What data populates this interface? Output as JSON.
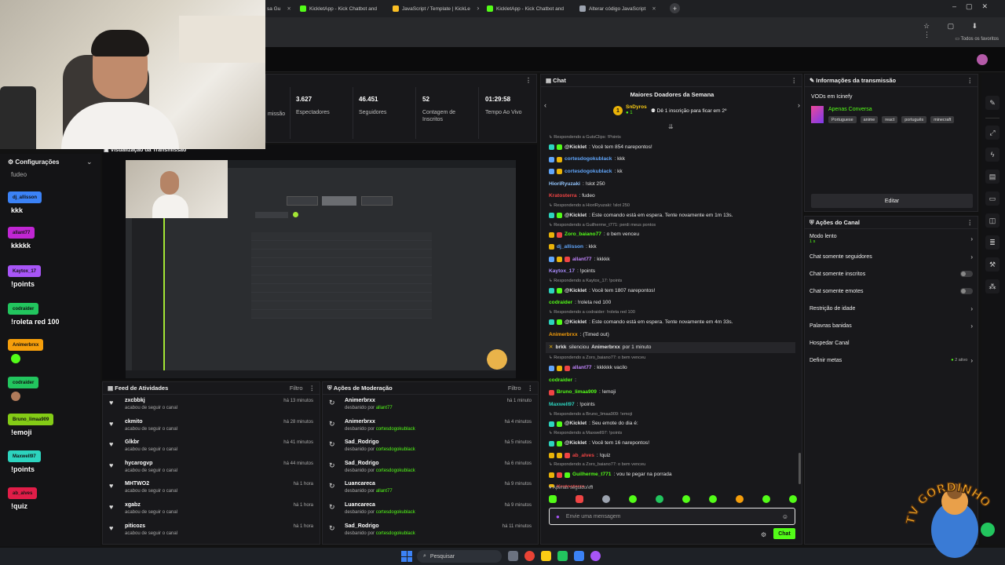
{
  "browser": {
    "tabs": [
      {
        "label": "sa Gu"
      },
      {
        "label": "KickletApp - Kick Chatbot and"
      },
      {
        "label": "JavaScript / Template | KickLe"
      },
      {
        "label": "KickletApp - Kick Chatbot and"
      },
      {
        "label": "Alterar código JavaScript"
      }
    ],
    "bookmarks_label": "Todos os favoritos"
  },
  "left_chat": {
    "config_label": "Configurações",
    "first_msg": "fudeo",
    "entries": [
      {
        "name": "dj_allisson",
        "color": "#3b82f6",
        "msg": "kkk"
      },
      {
        "name": "allant77",
        "color": "#c026d3",
        "msg": "kkkkk"
      },
      {
        "name": "Kaytox_17",
        "color": "#a855f7",
        "msg": "!points"
      },
      {
        "name": "codraider",
        "color": "#22c55e",
        "msg": "!roleta red 100"
      },
      {
        "name": "Animerbrxx",
        "color": "#f59e0b",
        "msg": ""
      },
      {
        "name": "codraider",
        "color": "#22c55e",
        "msg": ""
      },
      {
        "name": "Bruno_limaa909",
        "color": "#84cc16",
        "msg": "!emoji"
      },
      {
        "name": "Maxwell97",
        "color": "#2dd4bf",
        "msg": "!points"
      },
      {
        "name": "ab_alves",
        "color": "#e11d48",
        "msg": "!quiz"
      }
    ]
  },
  "stats": {
    "partial_label": "missão",
    "items": [
      {
        "value": "3.627",
        "label": "Espectadores"
      },
      {
        "value": "46.451",
        "label": "Seguidores"
      },
      {
        "value": "52",
        "label": "Contagem de Inscritos"
      },
      {
        "value": "01:29:58",
        "label": "Tempo Ao Vivo"
      }
    ]
  },
  "preview": {
    "title": "Visualização da Transmissão"
  },
  "activity": {
    "title": "Feed de Atividades",
    "filter": "Filtro",
    "items": [
      {
        "name": "zxcbbkj",
        "sub": "acabou de seguir o canal",
        "time": "há 13 minutos"
      },
      {
        "name": "ckmito",
        "sub": "acabou de seguir o canal",
        "time": "há 28 minutos"
      },
      {
        "name": "Glkbr",
        "sub": "acabou de seguir o canal",
        "time": "há 41 minutos"
      },
      {
        "name": "hycarogvp",
        "sub": "acabou de seguir o canal",
        "time": "há 44 minutos"
      },
      {
        "name": "MHTWO2",
        "sub": "acabou de seguir o canal",
        "time": "há 1 hora"
      },
      {
        "name": "xgabz",
        "sub": "acabou de seguir o canal",
        "time": "há 1 hora"
      },
      {
        "name": "piticozs",
        "sub": "acabou de seguir o canal",
        "time": "há 1 hora"
      }
    ]
  },
  "moderation": {
    "title": "Ações de Moderação",
    "filter": "Filtro",
    "items": [
      {
        "name": "Animerbrxx",
        "sub": "desbanido por",
        "by": "allant77",
        "time": "há 1 minuto"
      },
      {
        "name": "Animerbrxx",
        "sub": "desbanido por",
        "by": "cortesdogokublack",
        "time": "há 4 minutos"
      },
      {
        "name": "Sad_Rodrigo",
        "sub": "desbanido por",
        "by": "cortesdogokublack",
        "time": "há 5 minutos"
      },
      {
        "name": "Sad_Rodrigo",
        "sub": "desbanido por",
        "by": "cortesdogokublack",
        "time": "há 6 minutos"
      },
      {
        "name": "Luancareca",
        "sub": "desbanido por",
        "by": "allant77",
        "time": "há 9 minutos"
      },
      {
        "name": "Luancareca",
        "sub": "desbanido por",
        "by": "cortesdogokublack",
        "time": "há 9 minutos"
      },
      {
        "name": "Sad_Rodrigo",
        "sub": "desbanido por",
        "by": "cortesdogokublack",
        "time": "há 11 minutos"
      }
    ]
  },
  "chat": {
    "title": "Chat",
    "donors_title": "Maiores Doadores da Semana",
    "donor_name": "SnDyros",
    "donor_count": "1",
    "donor_note": "Dê 1 inscrição para ficar em 2º",
    "messages": [
      {
        "type": "reply",
        "text": "Respondendo a GutsClips: !Points"
      },
      {
        "type": "msg",
        "user": "@Kicklet",
        "ucolor": "#e6e6e6",
        "text": ": Você tem 854 narepontos!",
        "badges": [
          "#2dd4bf",
          "#53fc18"
        ]
      },
      {
        "type": "msg",
        "user": "cortesdogokublack",
        "ucolor": "#60a5fa",
        "text": ": kkk",
        "badges": [
          "#60a5fa",
          "#eab308"
        ]
      },
      {
        "type": "msg",
        "user": "cortesdogokublack",
        "ucolor": "#60a5fa",
        "text": ": kk",
        "badges": [
          "#60a5fa",
          "#eab308"
        ]
      },
      {
        "type": "msg",
        "user": "HioriRyuzaki",
        "ucolor": "#93c5fd",
        "text": ": !slot 250",
        "badges": []
      },
      {
        "type": "msg",
        "user": "Kratosterra",
        "ucolor": "#ef4444",
        "text": ": fudeo",
        "badges": []
      },
      {
        "type": "reply",
        "text": "Respondendo a HioriRyuzaki: !slot 250"
      },
      {
        "type": "msg",
        "user": "@Kicklet",
        "ucolor": "#e6e6e6",
        "text": ": Este comando está em espera. Tente novamente em 1m 13s.",
        "badges": [
          "#2dd4bf",
          "#53fc18"
        ]
      },
      {
        "type": "reply",
        "text": "Respondendo a Guilherme_t771: perdi meus pontos"
      },
      {
        "type": "msg",
        "user": "Zoro_baiano77",
        "ucolor": "#53fc18",
        "text": ": o bem venceu",
        "badges": [
          "#eab308",
          "#ef4444"
        ]
      },
      {
        "type": "msg",
        "user": "dj_allisson",
        "ucolor": "#60a5fa",
        "text": ": kkk",
        "badges": [
          "#eab308"
        ]
      },
      {
        "type": "msg",
        "user": "allant77",
        "ucolor": "#c084fc",
        "text": ": kkkkk",
        "badges": [
          "#60a5fa",
          "#eab308",
          "#ef4444"
        ]
      },
      {
        "type": "msg",
        "user": "Kaytox_17",
        "ucolor": "#a78bfa",
        "text": ": !points",
        "badges": []
      },
      {
        "type": "reply",
        "text": "Respondendo a Kaytox_17: !points"
      },
      {
        "type": "msg",
        "user": "@Kicklet",
        "ucolor": "#e6e6e6",
        "text": ": Você tem 1807 narepontos!",
        "badges": [
          "#2dd4bf",
          "#53fc18"
        ]
      },
      {
        "type": "msg",
        "user": "codraider",
        "ucolor": "#53fc18",
        "text": ": !roleta red 100",
        "badges": []
      },
      {
        "type": "reply",
        "text": "Respondendo a codraider: !roleta red 100"
      },
      {
        "type": "msg",
        "user": "@Kicklet",
        "ucolor": "#e6e6e6",
        "text": ": Este comando está em espera. Tente novamente em 4m 33s.",
        "badges": [
          "#2dd4bf",
          "#53fc18"
        ]
      },
      {
        "type": "msg",
        "user": "Animerbrxx",
        "ucolor": "#f59e0b",
        "text": ":   (Timed out)",
        "badges": []
      },
      {
        "type": "sys",
        "user": "brkk",
        "text": " silenciou ",
        "target": "Animerbrxx",
        "tail": " por 1 minuto"
      },
      {
        "type": "reply",
        "text": "Respondendo a Zoro_baiano77: o bem venceu"
      },
      {
        "type": "msg",
        "user": "allant77",
        "ucolor": "#c084fc",
        "text": ": kkkkkk vacilo",
        "badges": [
          "#60a5fa",
          "#eab308",
          "#ef4444"
        ]
      },
      {
        "type": "msg",
        "user": "codraider",
        "ucolor": "#53fc18",
        "text": ":",
        "badges": []
      },
      {
        "type": "msg",
        "user": "Bruno_limaa909",
        "ucolor": "#53fc18",
        "text": ": !emoji",
        "badges": [
          "#ef4444"
        ]
      },
      {
        "type": "msg",
        "user": "Maxwell97",
        "ucolor": "#2dd4bf",
        "text": ": !points",
        "badges": []
      },
      {
        "type": "reply",
        "text": "Respondendo a Bruno_limaa909: !emoji"
      },
      {
        "type": "msg",
        "user": "@Kicklet",
        "ucolor": "#e6e6e6",
        "text": ": Seu emote do dia é:",
        "badges": [
          "#2dd4bf",
          "#53fc18"
        ]
      },
      {
        "type": "reply",
        "text": "Respondendo a Maxwell97: !points"
      },
      {
        "type": "msg",
        "user": "@Kicklet",
        "ucolor": "#e6e6e6",
        "text": ": Você tem 16 narepontos!",
        "badges": [
          "#2dd4bf",
          "#53fc18"
        ]
      },
      {
        "type": "msg",
        "user": "ab_alves",
        "ucolor": "#ef4444",
        "text": ": !quiz",
        "badges": [
          "#eab308",
          "#eab308",
          "#ef4444"
        ]
      },
      {
        "type": "reply",
        "text": "Respondendo a Zoro_baiano77: o bem venceu"
      },
      {
        "type": "msg",
        "user": "Guilherme_t771",
        "ucolor": "#53fc18",
        "text": ": vou te pegar na porrada",
        "badges": [
          "#eab308",
          "#ef4444",
          "#53fc18"
        ]
      },
      {
        "type": "msg",
        "user": "Kratosterra",
        "ucolor": "#ef4444",
        "text": ": g",
        "badges": [
          "#eab308"
        ]
      }
    ],
    "followers_only": "Apenas seguidores",
    "input_placeholder": "Envie uma mensagem",
    "send_label": "Chat"
  },
  "stream_info": {
    "title": "Informações da transmissão",
    "vod_label": "VODs em Icinefy",
    "category": "Apenas Conversa",
    "tags": [
      "Portuguese",
      "anime",
      "react",
      "português",
      "minecraft"
    ],
    "edit_label": "Editar"
  },
  "channel_actions": {
    "title": "Ações do Canal",
    "slow_mode": "Modo lento",
    "slow_value": "1 s",
    "followers_only": "Chat somente seguidores",
    "subs_only": "Chat somente inscritos",
    "emotes_only": "Chat somente emotes",
    "age_restriction": "Restrição de idade",
    "banned_words": "Palavras banidas",
    "host": "Hospedar Canal",
    "goals": "Definir metas",
    "goals_active": "2 ativo"
  },
  "taskbar": {
    "search": "Pesquisar"
  },
  "logo": {
    "text": "TV GORDINHO"
  }
}
